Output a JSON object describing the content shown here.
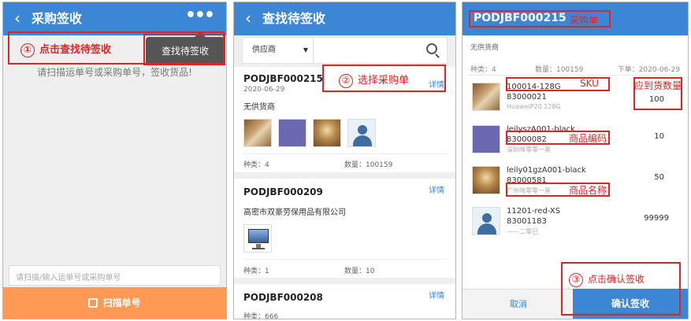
{
  "panel1": {
    "back_icon": "chevron-left-icon",
    "title": "采购签收",
    "more_icon": "more-dots-icon",
    "hint": "请扫描运单号或采购单号，签收货品!",
    "tooltip": "查找待签收",
    "annotation_num": "①",
    "annotation_text": "点击查找待签收",
    "scan_placeholder": "请扫描/输入运单号或采购单号",
    "scan_button": "扫描单号",
    "scan_button_color": "#ff9955"
  },
  "panel2": {
    "title": "查找待签收",
    "supplier_select": "供应商",
    "annotation_num": "②",
    "annotation_text": "选择采购单",
    "orders": [
      {
        "po": "PODJBF000215",
        "date": "2020-06-29",
        "detail": "详情",
        "supplier": "无供货商",
        "kind": "种类：4",
        "qty": "数量：100159"
      },
      {
        "po": "PODJBF000209",
        "detail": "详情",
        "supplier": "高密市双豪劳保用品有限公司",
        "kind": "种类：1",
        "qty": "数量：10"
      },
      {
        "po": "PODJBF000208",
        "detail": "详情",
        "kind": "种类：666"
      }
    ]
  },
  "panel3": {
    "title": "PODJBF000215",
    "title_tag": "采购单",
    "supplier": "无供货商",
    "kind": "种类：4",
    "qty": "数量：100159",
    "order_date": "下单：2020-06-29",
    "annotation_sku": "SKU",
    "annotation_qty": "应到货数量",
    "annotation_code": "商品编码",
    "annotation_name": "商品名称",
    "annotation_num": "③",
    "annotation_confirm": "点击确认签收",
    "items": [
      {
        "sku": "100014-128G",
        "code": "83000021",
        "name": "HuaweiP20 128G",
        "qty": "100"
      },
      {
        "sku": "leilyszA001-black",
        "code": "83000082",
        "name": "深圳咪零零一黑",
        "qty": "10"
      },
      {
        "sku": "leily01gzA001-black",
        "code": "83000581",
        "name": "广州咪零零一黑",
        "qty": "50"
      },
      {
        "sku": "11201-red-XS",
        "code": "83001183",
        "name": "——二零已",
        "qty": "99999"
      }
    ],
    "cancel": "取消",
    "confirm": "确认签收"
  },
  "colors": {
    "header": "#3c86d6",
    "annotation": "#e02424",
    "link": "#3a86d3"
  }
}
